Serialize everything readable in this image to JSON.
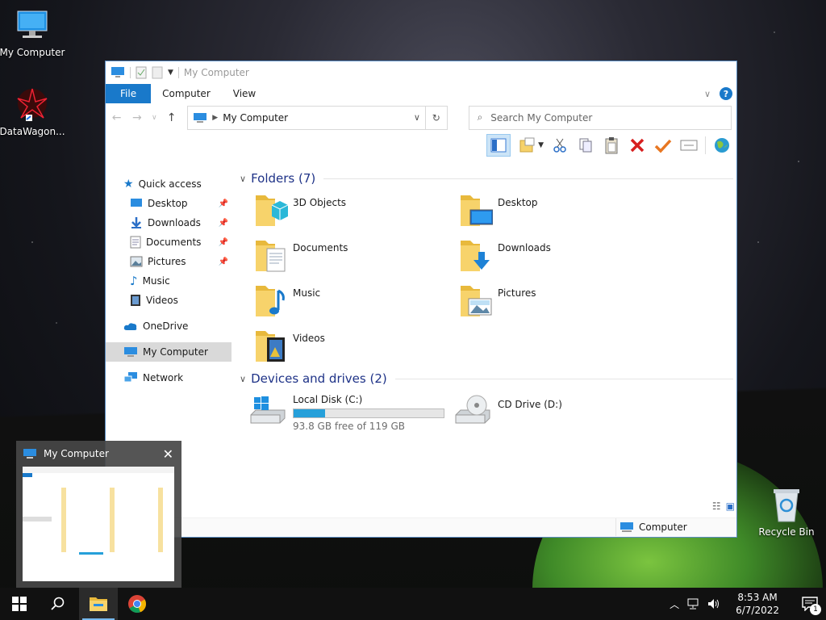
{
  "desktop": {
    "icons": [
      {
        "label": "My Computer",
        "icon": "computer-icon"
      },
      {
        "label": "DataWagon...",
        "icon": "datawagon-icon"
      },
      {
        "label": "Recycle Bin",
        "icon": "recycle-bin-icon"
      }
    ]
  },
  "window": {
    "title": "My Computer",
    "ribbon_tabs": [
      "File",
      "Computer",
      "View"
    ],
    "address": "My Computer",
    "search_placeholder": "Search My Computer",
    "nav": {
      "quick_access": "Quick access",
      "quick_items": [
        {
          "label": "Desktop",
          "pinned": true
        },
        {
          "label": "Downloads",
          "pinned": true
        },
        {
          "label": "Documents",
          "pinned": true
        },
        {
          "label": "Pictures",
          "pinned": true
        },
        {
          "label": "Music",
          "pinned": false
        },
        {
          "label": "Videos",
          "pinned": false
        }
      ],
      "onedrive": "OneDrive",
      "my_computer": "My Computer",
      "network": "Network"
    },
    "folders_header": "Folders (7)",
    "folders": [
      "3D Objects",
      "Desktop",
      "Documents",
      "Downloads",
      "Music",
      "Pictures",
      "Videos"
    ],
    "drives_header": "Devices and drives (2)",
    "drives": [
      {
        "name": "Local Disk (C:)",
        "free": "93.8 GB free of 119 GB",
        "used_fraction": 0.21
      },
      {
        "name": "CD Drive (D:)"
      }
    ],
    "status_computer": "Computer"
  },
  "thumbnail": {
    "title": "My Computer"
  },
  "taskbar": {
    "time": "8:53 AM",
    "date": "6/7/2022",
    "notifications": "1"
  }
}
